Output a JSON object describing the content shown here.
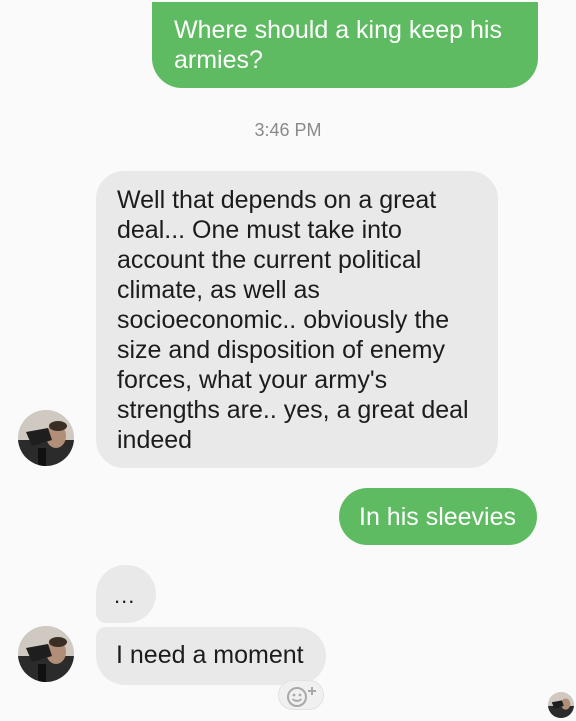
{
  "messages": {
    "m1": "Where should a king keep his armies?",
    "timestamp": "3:46 PM",
    "m2": "Well that depends on a great\ndeal... One must take into\naccount the current political\nclimate, as well as\nsocioeconomic.. obviously the\nsize and disposition of enemy\nforces, what your army's\nstrengths are.. yes, a great deal\nindeed",
    "m3": "In his sleevies",
    "m4": "...",
    "m5": "I need a moment"
  },
  "icons": {
    "avatar": "contact-avatar-photo",
    "reaction": "add-reaction-smiley-icon",
    "read_receipt": "read-receipt-avatar"
  },
  "colors": {
    "sent_bubble": "#5ebb62",
    "received_bubble": "#e9e9ea",
    "background": "#fafafa"
  }
}
